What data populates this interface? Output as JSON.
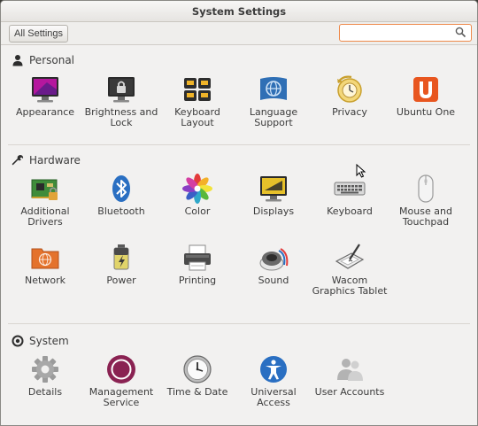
{
  "window": {
    "title": "System Settings"
  },
  "toolbar": {
    "all_settings_label": "All Settings",
    "search_value": "",
    "search_placeholder": ""
  },
  "sections": {
    "personal": {
      "title": "Personal",
      "items": [
        {
          "label": "Appearance",
          "icon": "appearance-icon"
        },
        {
          "label": "Brightness and Lock",
          "icon": "brightness-lock-icon"
        },
        {
          "label": "Keyboard Layout",
          "icon": "keyboard-layout-icon"
        },
        {
          "label": "Language Support",
          "icon": "language-icon"
        },
        {
          "label": "Privacy",
          "icon": "privacy-icon"
        },
        {
          "label": "Ubuntu One",
          "icon": "ubuntu-one-icon"
        }
      ]
    },
    "hardware": {
      "title": "Hardware",
      "items": [
        {
          "label": "Additional Drivers",
          "icon": "drivers-icon"
        },
        {
          "label": "Bluetooth",
          "icon": "bluetooth-icon"
        },
        {
          "label": "Color",
          "icon": "color-icon"
        },
        {
          "label": "Displays",
          "icon": "displays-icon"
        },
        {
          "label": "Keyboard",
          "icon": "keyboard-icon"
        },
        {
          "label": "Mouse and Touchpad",
          "icon": "mouse-icon"
        },
        {
          "label": "Network",
          "icon": "network-icon"
        },
        {
          "label": "Power",
          "icon": "power-icon"
        },
        {
          "label": "Printing",
          "icon": "printer-icon"
        },
        {
          "label": "Sound",
          "icon": "sound-icon"
        },
        {
          "label": "Wacom Graphics Tablet",
          "icon": "wacom-icon"
        }
      ]
    },
    "system": {
      "title": "System",
      "items": [
        {
          "label": "Details",
          "icon": "details-gear-icon"
        },
        {
          "label": "Management Service",
          "icon": "management-icon"
        },
        {
          "label": "Time & Date",
          "icon": "clock-icon"
        },
        {
          "label": "Universal Access",
          "icon": "accessibility-icon"
        },
        {
          "label": "User Accounts",
          "icon": "users-icon"
        }
      ]
    }
  },
  "colors": {
    "window_bg": "#f2f1f0",
    "search_focus": "#ee8a4c",
    "ubuntu_orange": "#e8561f",
    "management_purple": "#8a2252"
  }
}
